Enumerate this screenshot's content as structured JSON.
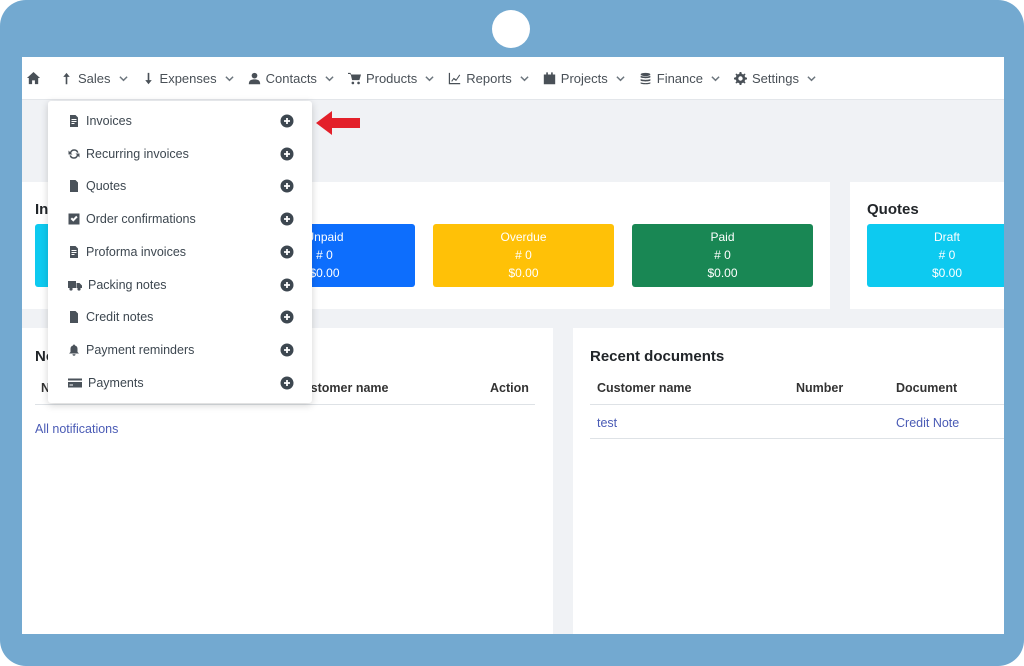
{
  "nav": {
    "home_icon": "home-icon",
    "items": [
      {
        "label": "Sales",
        "icon": "arrow-up-icon"
      },
      {
        "label": "Expenses",
        "icon": "arrow-down-icon"
      },
      {
        "label": "Contacts",
        "icon": "user-icon"
      },
      {
        "label": "Products",
        "icon": "cart-icon"
      },
      {
        "label": "Reports",
        "icon": "chart-icon"
      },
      {
        "label": "Projects",
        "icon": "calendar-icon"
      },
      {
        "label": "Finance",
        "icon": "coins-icon"
      },
      {
        "label": "Settings",
        "icon": "gear-icon"
      }
    ]
  },
  "sales_menu": {
    "items": [
      {
        "label": "Invoices",
        "icon": "file-invoice-icon"
      },
      {
        "label": "Recurring invoices",
        "icon": "sync-icon"
      },
      {
        "label": "Quotes",
        "icon": "file-icon"
      },
      {
        "label": "Order confirmations",
        "icon": "check-square-icon"
      },
      {
        "label": "Proforma invoices",
        "icon": "file-invoice-icon"
      },
      {
        "label": "Packing notes",
        "icon": "truck-icon"
      },
      {
        "label": "Credit notes",
        "icon": "file-icon"
      },
      {
        "label": "Payment reminders",
        "icon": "bell-icon"
      },
      {
        "label": "Payments",
        "icon": "credit-card-icon"
      }
    ]
  },
  "invoices_card": {
    "title_fragment": "In",
    "stats": [
      {
        "label": "Unpaid",
        "count": "# 0",
        "amount": "$0.00",
        "color": "#0d6efd"
      },
      {
        "label": "Overdue",
        "count": "# 0",
        "amount": "$0.00",
        "color": "#ffc107"
      },
      {
        "label": "Paid",
        "count": "# 0",
        "amount": "$0.00",
        "color": "#198754"
      }
    ],
    "cut_stat_color": "#0dcaf0"
  },
  "quotes_card": {
    "title": "Quotes",
    "stats": [
      {
        "label": "Draft",
        "count": "# 0",
        "amount": "$0.00",
        "color": "#0dcaf0"
      }
    ]
  },
  "notifications_card": {
    "title_fragment": "No",
    "col_fragment": "N",
    "headers": [
      "Customer name",
      "Action"
    ],
    "all_link": "All notifications"
  },
  "recent_card": {
    "title": "Recent documents",
    "headers": [
      "Customer name",
      "Number",
      "Document"
    ],
    "rows": [
      {
        "customer": "test",
        "number": "",
        "document": "Credit Note"
      }
    ]
  },
  "colors": {
    "frame": "#73a9d0",
    "annotation_arrow": "#e3202a"
  }
}
